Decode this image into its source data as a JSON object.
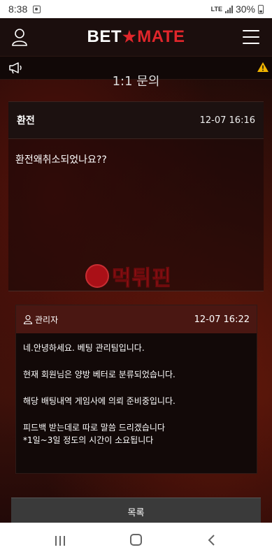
{
  "status_bar": {
    "time": "8:38",
    "network": "LTE",
    "battery": "30%"
  },
  "header": {
    "logo_left": "BET",
    "logo_right": "MATE"
  },
  "page": {
    "title": "1:1 문의"
  },
  "question": {
    "subject": "환전",
    "date": "12-07 16:16",
    "body": "환전왜취소되었나요??"
  },
  "watermark": {
    "text": "먹튀핀"
  },
  "reply": {
    "author": "관리자",
    "date": "12-07 16:22",
    "lines": [
      "네.안녕하세요. 베팅 관리팀입니다.",
      "현재 회원님은 양방 베터로 분류되었습니다.",
      "해당 배팅내역 게임사에 의뢰 준비중입니다.",
      "피드백 받는데로 따로 말씀 드리겠습니다",
      "*1일~3일 정도의 시간이 소요됩니다"
    ]
  },
  "buttons": {
    "list_label": "목록"
  },
  "colors": {
    "brand_red": "#e0262b",
    "reply_header": "#4a1712",
    "warning": "#f0b400"
  }
}
